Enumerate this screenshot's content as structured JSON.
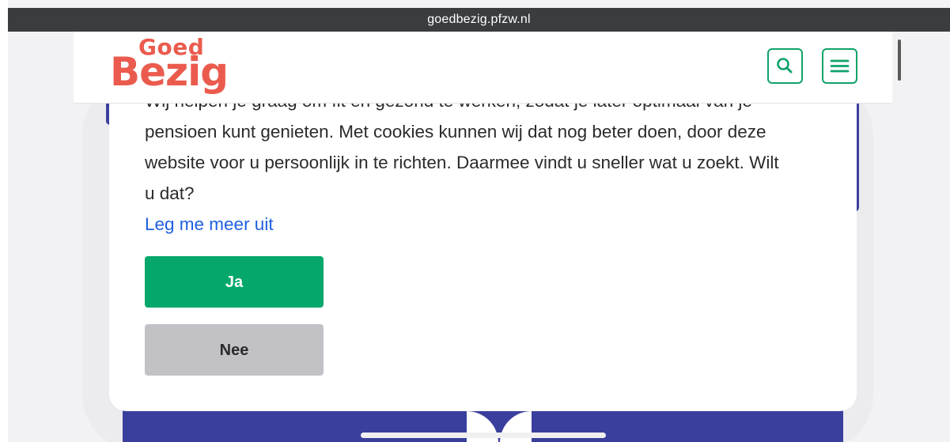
{
  "browser": {
    "url": "goedbezig.pfzw.nl"
  },
  "header": {
    "logo_top": "Goed",
    "logo_bottom": "Bezig",
    "search_icon": "search-icon",
    "menu_icon": "hamburger-menu-icon"
  },
  "cookie_dialog": {
    "text_lines": [
      "Wij helpen je graag om fit en gezond te werken, zodat je later optimaal van je",
      "pensioen kunt genieten. Met cookies kunnen wij dat nog beter doen, door deze",
      "website voor u persoonlijk in te richten. Daarmee vindt u sneller wat u zoekt. Wilt",
      "u dat?"
    ],
    "more_link": "Leg me meer uit",
    "accept_label": "Ja",
    "decline_label": "Nee"
  },
  "colors": {
    "brand_red": "#ea5b4e",
    "accent_green": "#05a86a",
    "link_blue": "#1f5fe0",
    "decline_gray": "#c2c2c6",
    "background_blue": "#3a3f9e"
  }
}
